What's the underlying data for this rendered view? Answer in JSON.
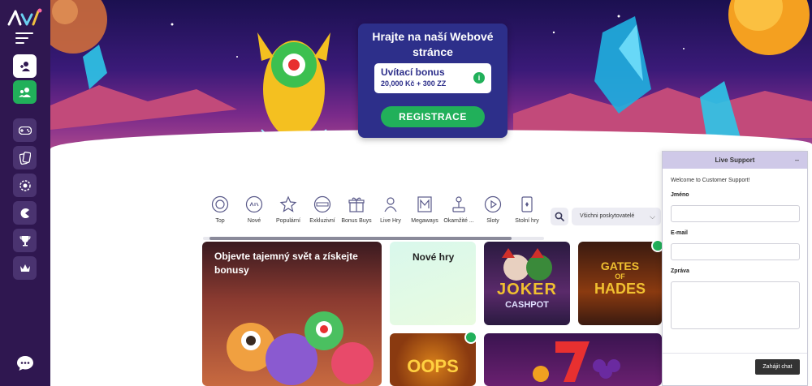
{
  "sidebar": {
    "logo_icon": "brand-logo",
    "items": [
      {
        "name": "login",
        "icon": "user-login-icon"
      },
      {
        "name": "register",
        "icon": "users-add-icon"
      },
      {
        "name": "games",
        "icon": "gamepad-icon"
      },
      {
        "name": "cards",
        "icon": "cards-icon"
      },
      {
        "name": "live",
        "icon": "chip-icon"
      },
      {
        "name": "promotions",
        "icon": "pacman-icon"
      },
      {
        "name": "tournaments",
        "icon": "trophy-icon"
      },
      {
        "name": "vip",
        "icon": "crown-icon"
      }
    ],
    "chat_icon": "chat-bubble-icon"
  },
  "promo": {
    "title": "Hrajte na naší Webové stránce",
    "bonus_label": "Uvítací bonus",
    "bonus_amount": "20,000 Kč + 300 ZZ",
    "info": "i",
    "cta": "REGISTRACE"
  },
  "categories": [
    {
      "label": "Top",
      "icon": "top-icon"
    },
    {
      "label": "Nové",
      "icon": "new-icon"
    },
    {
      "label": "Populární",
      "icon": "star-icon"
    },
    {
      "label": "Exkluzivní",
      "icon": "exclusive-icon"
    },
    {
      "label": "Bonus Buys",
      "icon": "gift-icon"
    },
    {
      "label": "Live Hry",
      "icon": "dealer-icon"
    },
    {
      "label": "Megaways",
      "icon": "megaways-icon"
    },
    {
      "label": "Okamžité ...",
      "icon": "joystick-icon"
    },
    {
      "label": "Sloty",
      "icon": "play-icon"
    },
    {
      "label": "Stolní hry",
      "icon": "card-table-icon"
    }
  ],
  "filters": {
    "search_icon": "search-icon",
    "provider_select": "Všichni poskytovatelé"
  },
  "games": {
    "feature_title": "Objevte tajemný svět a získejte bonusy",
    "new_games_title": "Nové hry",
    "joker_art": [
      "JOKER",
      "CASHPOT"
    ],
    "hades_art": [
      "GATES",
      "OF",
      "HADES"
    ],
    "oops_art": "OOPS"
  },
  "support": {
    "title": "Live Support",
    "minimize": "–",
    "welcome": "Welcome to Customer Support!",
    "name_label": "Jméno",
    "email_label": "E-mail",
    "message_label": "Zpráva",
    "start_button": "Zahájit chat"
  },
  "colors": {
    "sidebar": "#2f1750",
    "accent_green": "#21b05a",
    "promo_card": "#2d2f8a"
  }
}
